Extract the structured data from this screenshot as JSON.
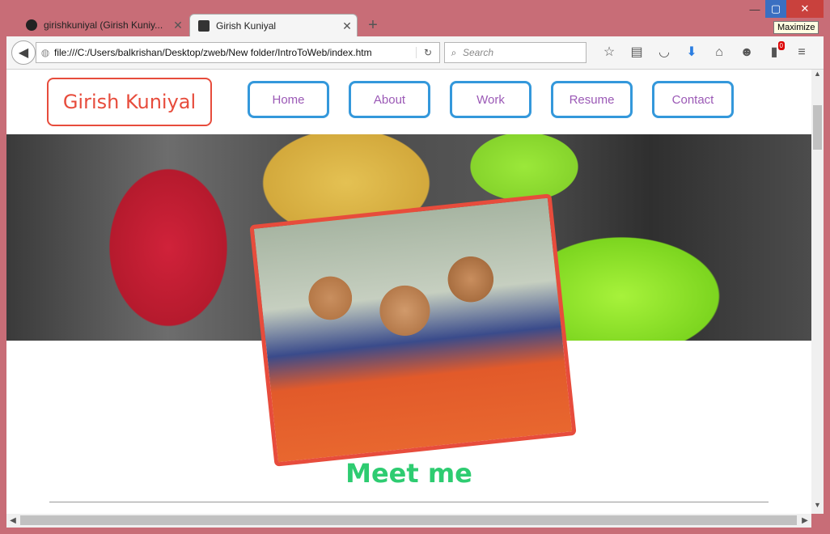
{
  "browser": {
    "tabs": [
      {
        "title": "girishkuniyal (Girish Kuniy...",
        "active": false,
        "favicon": "github-icon"
      },
      {
        "title": "Girish Kuniyal",
        "active": true,
        "favicon": "page-icon"
      }
    ],
    "url": "file:///C:/Users/balkrishan/Desktop/zweb/New folder/IntroToWeb/index.htm",
    "search_placeholder": "Search",
    "tooltip": "Maximize",
    "downloads_badge": "0"
  },
  "page": {
    "logo": "Girish Kuniyal",
    "nav": [
      "Home",
      "About",
      "Work",
      "Resume",
      "Contact"
    ],
    "heading": "Meet me"
  },
  "colors": {
    "logo": "#e74c3c",
    "nav_border": "#3498db",
    "nav_text": "#9b59b6",
    "heading": "#2ecc71",
    "window_frame": "#c86d77"
  }
}
